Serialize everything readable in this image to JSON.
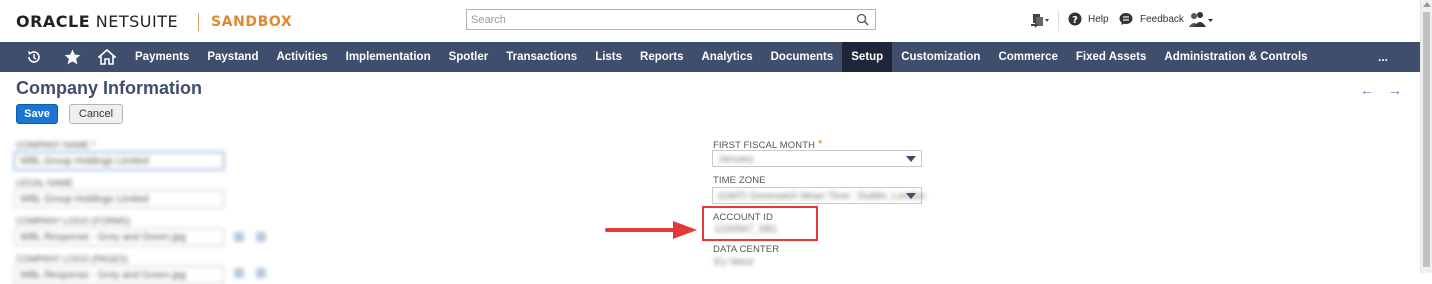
{
  "header": {
    "brand_bold": "ORACLE",
    "brand_rest": "NETSUITE",
    "environment": "SANDBOX",
    "search_placeholder": "Search",
    "help_label": "Help",
    "feedback_label": "Feedback"
  },
  "nav": {
    "items": [
      "Payments",
      "Paystand",
      "Activities",
      "Implementation",
      "Spotler",
      "Transactions",
      "Lists",
      "Reports",
      "Analytics",
      "Documents",
      "Setup",
      "Customization",
      "Commerce",
      "Fixed Assets",
      "Administration & Controls"
    ],
    "active": "Setup",
    "more_label": "..."
  },
  "page": {
    "title": "Company Information",
    "back_arrow": "←",
    "forward_arrow": "→",
    "save_label": "Save",
    "cancel_label": "Cancel"
  },
  "right_fields": {
    "fiscal_month_label": "FIRST FISCAL MONTH",
    "required_mark": "*",
    "fiscal_month_value": "January",
    "timezone_label": "TIME ZONE",
    "timezone_value": "(GMT) Greenwich Mean Time : Dublin, London",
    "account_id_label": "ACCOUNT ID",
    "account_id_value": "1234567_SB1",
    "data_center_label": "DATA CENTER",
    "data_center_value": "EU West"
  },
  "left_fields": {
    "company_name_label": "COMPANY NAME *",
    "company_name_value": "WBL Group Holdings Limited",
    "legal_name_label": "LEGAL NAME",
    "legal_name_value": "WBL Group Holdings Limited",
    "logo_forms_label": "COMPANY LOGO (FORMS)",
    "logo_forms_value": "WBL Response - Grey and Green.jpg",
    "logo_pages_label": "COMPANY LOGO (PAGES)",
    "logo_pages_value": "WBL Response - Grey and Green.jpg"
  },
  "colors": {
    "nav_background": "#3f4e6c",
    "nav_active": "#20263a",
    "accent_orange": "#e0892f",
    "save_button": "#1b75d3",
    "annotation_red": "#e53935"
  }
}
